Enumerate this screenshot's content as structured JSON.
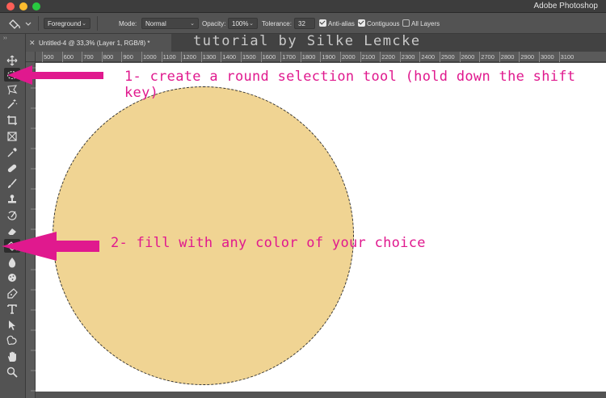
{
  "window": {
    "app_title": "Adobe Photoshop"
  },
  "options_bar": {
    "fill_source": "Foreground",
    "mode_label": "Mode:",
    "mode_value": "Normal",
    "opacity_label": "Opacity:",
    "opacity_value": "100%",
    "tolerance_label": "Tolerance:",
    "tolerance_value": "32",
    "anti_alias_label": "Anti-alias",
    "anti_alias_checked": true,
    "contiguous_label": "Contiguous",
    "contiguous_checked": true,
    "all_layers_label": "All Layers",
    "all_layers_checked": false
  },
  "document": {
    "tab_label": "Untitled-4 @ 33,3% (Layer 1, RGB/8) *",
    "overlay_text": "tutorial by Silke Lemcke"
  },
  "ruler": {
    "ticks": [
      "500",
      "600",
      "700",
      "800",
      "900",
      "1000",
      "1100",
      "1200",
      "1300",
      "1400",
      "1500",
      "1600",
      "1700",
      "1800",
      "1900",
      "2000",
      "2100",
      "2200",
      "2300",
      "2400",
      "2500",
      "2600",
      "2700",
      "2800",
      "2900",
      "3000",
      "3100"
    ]
  },
  "toolbar": {
    "tools": [
      {
        "name": "move-tool",
        "icon": "move-icon"
      },
      {
        "name": "elliptical-marquee-tool",
        "icon": "ellipse-marquee-icon"
      },
      {
        "name": "lasso-tool",
        "icon": "lasso-icon"
      },
      {
        "name": "magic-wand-tool",
        "icon": "magic-wand-icon"
      },
      {
        "name": "crop-tool",
        "icon": "crop-icon"
      },
      {
        "name": "frame-tool",
        "icon": "frame-icon"
      },
      {
        "name": "eyedropper-tool",
        "icon": "eyedropper-icon"
      },
      {
        "name": "healing-brush-tool",
        "icon": "bandage-icon"
      },
      {
        "name": "brush-tool",
        "icon": "brush-icon"
      },
      {
        "name": "clone-stamp-tool",
        "icon": "stamp-icon"
      },
      {
        "name": "history-brush-tool",
        "icon": "history-brush-icon"
      },
      {
        "name": "eraser-tool",
        "icon": "eraser-icon"
      },
      {
        "name": "paint-bucket-tool",
        "icon": "paint-bucket-icon"
      },
      {
        "name": "blur-tool",
        "icon": "drop-icon"
      },
      {
        "name": "sponge-tool",
        "icon": "sponge-icon"
      },
      {
        "name": "pen-tool",
        "icon": "pen-icon"
      },
      {
        "name": "type-tool",
        "icon": "type-icon"
      },
      {
        "name": "path-selection-tool",
        "icon": "arrow-pointer-icon"
      },
      {
        "name": "custom-shape-tool",
        "icon": "shape-icon"
      },
      {
        "name": "hand-tool",
        "icon": "hand-icon"
      },
      {
        "name": "zoom-tool",
        "icon": "zoom-icon"
      }
    ]
  },
  "canvas": {
    "fill_color": "#f0d493"
  },
  "annotations": {
    "step1": "1- create a round selection tool (hold down the shift key)",
    "step2": "2- fill with any color of your choice",
    "color": "#e0198e"
  }
}
